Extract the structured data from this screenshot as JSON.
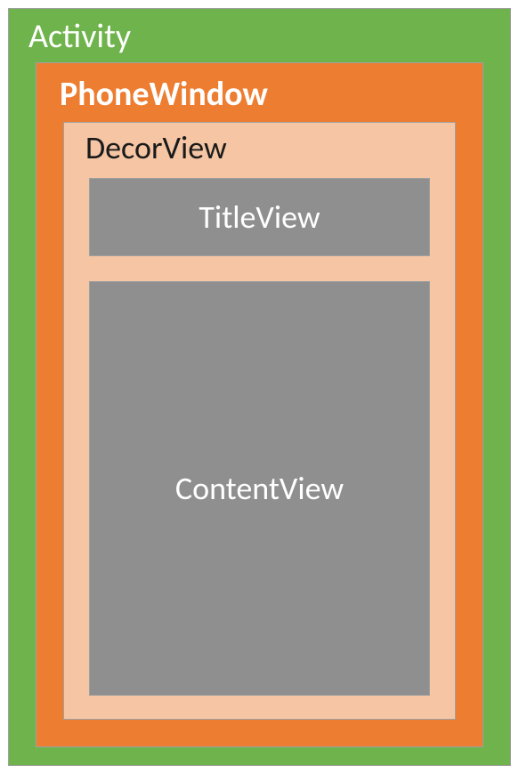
{
  "activity": {
    "label": "Activity"
  },
  "phonewindow": {
    "label": "PhoneWindow"
  },
  "decorview": {
    "label": "DecorView"
  },
  "titleview": {
    "label": "TitleView"
  },
  "contentview": {
    "label": "ContentView"
  }
}
